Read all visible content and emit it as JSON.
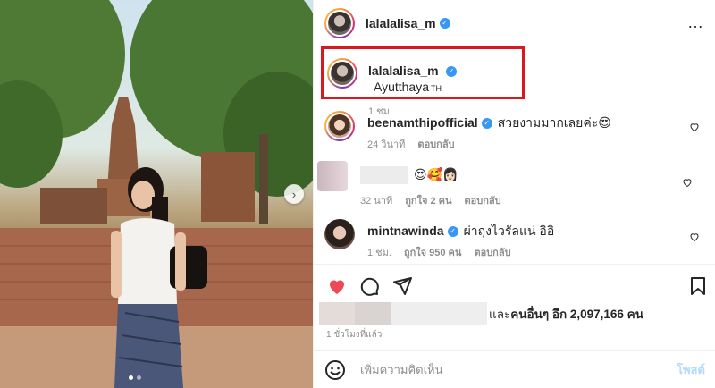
{
  "post": {
    "author": "lalalalisa_m",
    "caption_author": "lalalalisa_m",
    "location": "Ayutthaya",
    "location_suffix": "TH",
    "caption_time": "1 ชม.",
    "more_icon": "…"
  },
  "comments": [
    {
      "username": "beenamthipofficial",
      "text": "สวยงามมากเลยค่ะ😍",
      "time": "24 วินาที",
      "reply": "ตอบกลับ",
      "likes": ""
    },
    {
      "username": "",
      "text": "😍🥰👩🏻",
      "time": "32 นาที",
      "likes": "ถูกใจ 2 คน",
      "reply": "ตอบกลับ"
    },
    {
      "username": "mintnawinda",
      "text": "ผ่าถุงไวรัลแน่ อิอิ",
      "time": "1 ชม.",
      "likes": "ถูกใจ 950 คน",
      "reply": "ตอบกลับ"
    }
  ],
  "likes": {
    "prefix": "และ",
    "others": "คนอื่นๆ อีก 2,097,166 คน"
  },
  "posted_time": "1 ชั่วโมงที่แล้ว",
  "add_comment": {
    "placeholder": "เพิ่มความคิดเห็น",
    "post_label": "โพสต์"
  },
  "carousel": {
    "next_icon": "›",
    "slide_count": 2,
    "active_slide": 0
  },
  "colors": {
    "like_red": "#ed4956",
    "verified_blue": "#3897f0",
    "highlight_red": "#d9181f"
  }
}
